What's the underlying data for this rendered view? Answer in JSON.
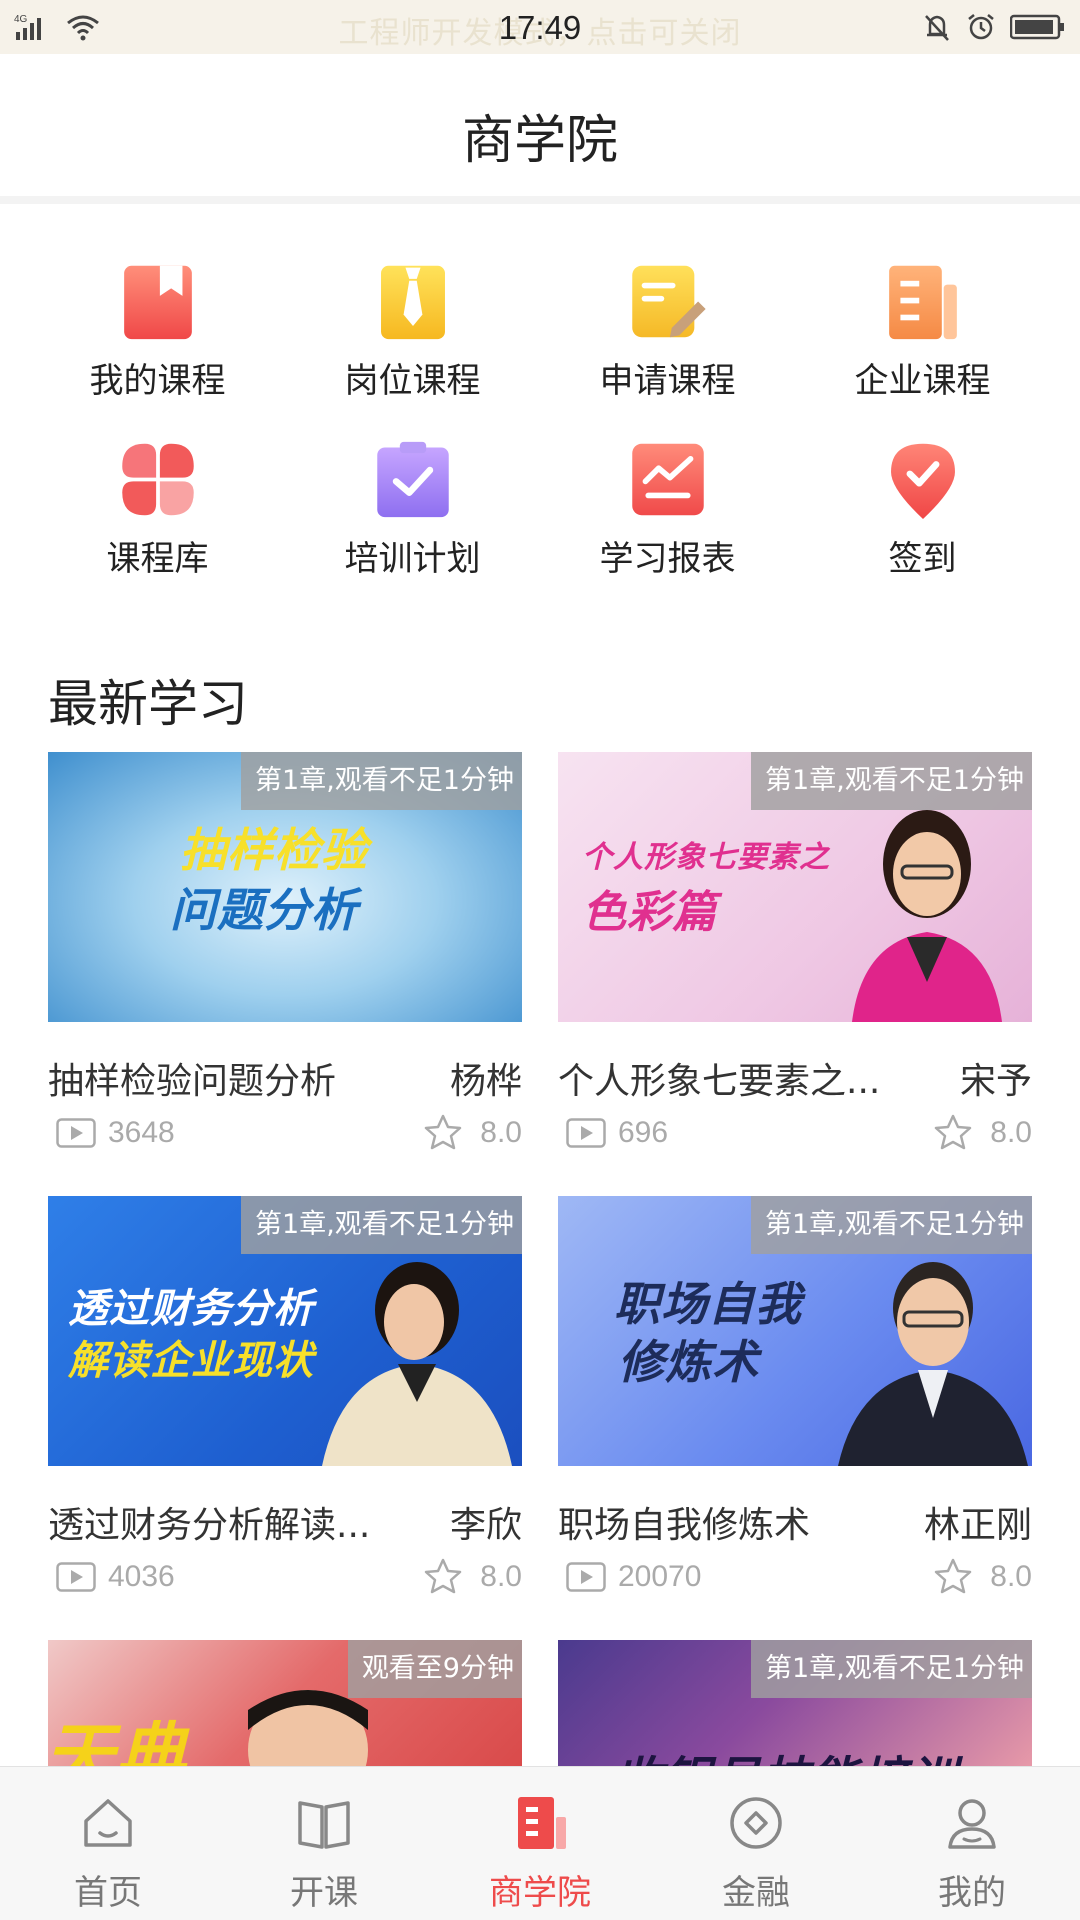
{
  "status_bar": {
    "network": "4G",
    "notice": "工程师开发模式，点击可关闭",
    "time": "17:49"
  },
  "header": {
    "title": "商学院"
  },
  "menu": [
    {
      "label": "我的课程",
      "icon": "bookmark-icon",
      "color": "#f25a5a"
    },
    {
      "label": "岗位课程",
      "icon": "tie-icon",
      "color": "#f7c82c"
    },
    {
      "label": "申请课程",
      "icon": "note-pencil-icon",
      "color": "#f8c93a"
    },
    {
      "label": "企业课程",
      "icon": "document-icon",
      "color": "#f59a53"
    },
    {
      "label": "课程库",
      "icon": "grid-petals-icon",
      "color": "#f36b6b"
    },
    {
      "label": "培训计划",
      "icon": "clipboard-check-icon",
      "color": "#9a7bf0"
    },
    {
      "label": "学习报表",
      "icon": "report-chart-icon",
      "color": "#f05a5a"
    },
    {
      "label": "签到",
      "icon": "location-check-icon",
      "color": "#f25a5a"
    }
  ],
  "section": {
    "title": "最新学习"
  },
  "courses": [
    {
      "badge": "第1章,观看不足1分钟",
      "thumb_line1": "抽样检验",
      "thumb_line2": "问题分析",
      "title": "抽样检验问题分析",
      "teacher": "杨桦",
      "views": "3648",
      "rating": "8.0"
    },
    {
      "badge": "第1章,观看不足1分钟",
      "thumb_line1": "个人形象七要素之",
      "thumb_line2": "色彩篇",
      "title": "个人形象七要素之...",
      "teacher": "宋予",
      "views": "696",
      "rating": "8.0"
    },
    {
      "badge": "第1章,观看不足1分钟",
      "thumb_line1": "透过财务分析",
      "thumb_line2": "解读企业现状",
      "title": "透过财务分析解读...",
      "teacher": "李欣",
      "views": "4036",
      "rating": "8.0"
    },
    {
      "badge": "第1章,观看不足1分钟",
      "thumb_line1": "职场自我",
      "thumb_line2": "修炼术",
      "title": "职场自我修炼术",
      "teacher": "林正刚",
      "views": "20070",
      "rating": "8.0"
    },
    {
      "badge": "观看至9分钟",
      "thumb_line1": "天典"
    },
    {
      "badge": "第1章,观看不足1分钟",
      "thumb_line1": "收银员技能培训"
    }
  ],
  "tabs": [
    {
      "label": "首页",
      "icon": "home-icon",
      "active": false
    },
    {
      "label": "开课",
      "icon": "open-book-icon",
      "active": false
    },
    {
      "label": "商学院",
      "icon": "building-icon",
      "active": true
    },
    {
      "label": "金融",
      "icon": "finance-icon",
      "active": false
    },
    {
      "label": "我的",
      "icon": "user-icon",
      "active": false
    }
  ],
  "colors": {
    "accent": "#ee4b4b",
    "status_bar_bg": "#f6f2e9"
  }
}
